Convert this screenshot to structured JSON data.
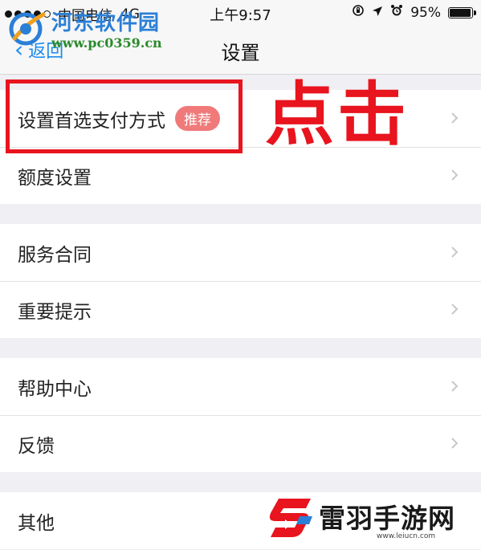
{
  "status_bar": {
    "carrier": "中国电信",
    "network": "4G",
    "time": "上午9:57",
    "battery": "95%",
    "battery_level": 0.95
  },
  "nav": {
    "back_label": "返回",
    "title": "设置"
  },
  "sections": [
    {
      "rows": [
        {
          "label": "设置首选支付方式",
          "badge": "推荐"
        },
        {
          "label": "额度设置"
        }
      ]
    },
    {
      "rows": [
        {
          "label": "服务合同"
        },
        {
          "label": "重要提示"
        }
      ]
    },
    {
      "rows": [
        {
          "label": "帮助中心"
        },
        {
          "label": "反馈"
        }
      ]
    },
    {
      "rows": [
        {
          "label": "其他"
        }
      ]
    }
  ],
  "annotation": {
    "text": "点击",
    "color": "#e8141e"
  },
  "watermarks": {
    "top_name": "河东软件园",
    "top_url": "www.pc0359.cn",
    "bottom_name": "雷羽手游网",
    "bottom_url": "www.leiucn.com"
  },
  "colors": {
    "accent_blue": "#1e8bf0",
    "badge": "#f07a7a",
    "highlight": "#e8141e"
  },
  "icons": {
    "back": "chevron-left-icon",
    "row_arrow": "chevron-right-icon",
    "location": "location-arrow-icon",
    "alarm": "alarm-icon",
    "rotation_lock": "rotation-lock-icon",
    "battery": "battery-icon"
  }
}
